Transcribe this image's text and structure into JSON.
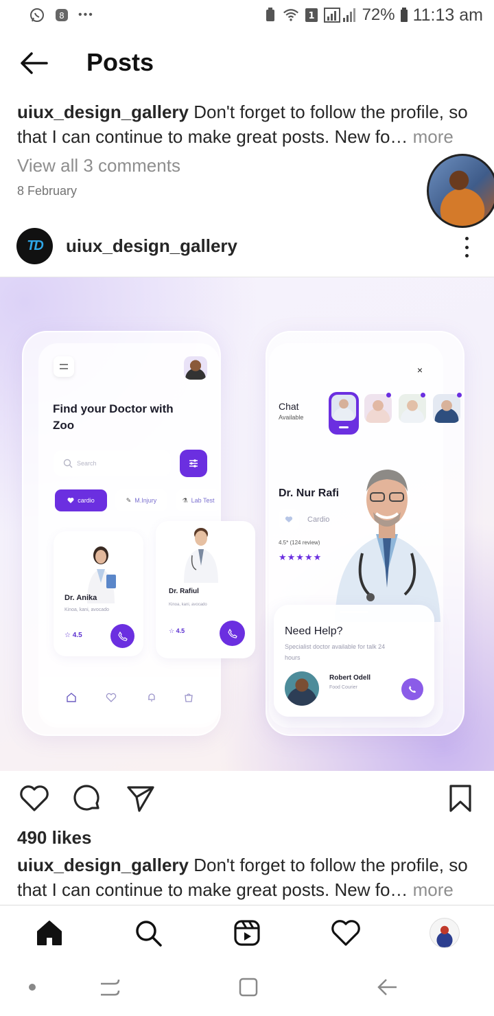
{
  "status_bar": {
    "left_icons": [
      "whatsapp-icon",
      "app-s-icon",
      "more-notifications-icon"
    ],
    "right_icons": [
      "battery-saver-icon",
      "wifi-icon",
      "sim-1-icon",
      "signal-icon"
    ],
    "overflow": "•••",
    "battery": "72%",
    "time": "11:13 am"
  },
  "header": {
    "title": "Posts",
    "back_icon": "arrow-left-icon"
  },
  "top_caption": {
    "username": "uiux_design_gallery",
    "text": " Don't forget to follow the profile, so that I can continue to make great posts. New fo…",
    "more": " more"
  },
  "comments": {
    "view_all": "View all 3 comments"
  },
  "post_date": "8 February",
  "post": {
    "username": "uiux_design_gallery",
    "avatar_text": "TD",
    "options_icon": "more-vertical-icon"
  },
  "post_image": {
    "left_app": {
      "heading": "Find your Doctor with Zoo",
      "search_placeholder": "Search",
      "chips": [
        "cardio",
        "M.Injury",
        "Lab Test"
      ],
      "cards": [
        {
          "name": "Dr. Anika",
          "desc": "Kinoa, kani, avocado",
          "rating": "4.5"
        },
        {
          "name": "Dr. Rafiul",
          "desc": "Kinoa, kani, avocado",
          "rating": "4.5"
        }
      ]
    },
    "right_app": {
      "chat_title": "Chat",
      "chat_sub": "Available",
      "doctor_name": "Dr. Nur Rafi",
      "specialty": "Cardio",
      "review": "4.5* (124 review)",
      "stars": "★★★★★",
      "help_title": "Need Help?",
      "help_sub": "Specialist doctor available for talk 24 hours",
      "courier_name": "Robert Odell",
      "courier_role": "Food Courier",
      "close": "×"
    }
  },
  "actions": {
    "like_icon": "heart-icon",
    "comment_icon": "comment-icon",
    "share_icon": "send-icon",
    "save_icon": "bookmark-icon"
  },
  "likes": "490 likes",
  "bottom_caption": {
    "username": "uiux_design_gallery",
    "text": " Don't forget to follow the profile, so that I can continue to make great posts. New fo…",
    "more": " more"
  },
  "bottom_nav": [
    "home-icon",
    "search-icon",
    "reels-icon",
    "activity-heart-icon",
    "profile-avatar"
  ],
  "android_nav": [
    "dot-icon",
    "recents-icon",
    "home-square-icon",
    "back-icon"
  ],
  "colors": {
    "accent_purple": "#6b2fe0",
    "text": "#262626",
    "muted": "#8e8e8e"
  }
}
